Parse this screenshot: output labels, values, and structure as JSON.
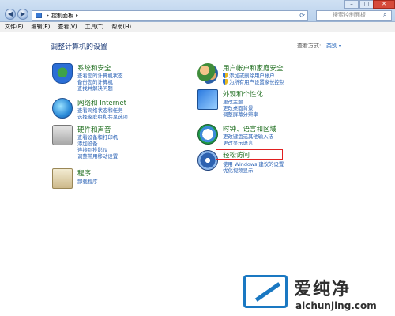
{
  "window": {
    "breadcrumb": [
      "控制面板"
    ],
    "search_placeholder": "搜索控制面板",
    "controls": {
      "minimize": "–",
      "maximize": "□",
      "close": "✕"
    }
  },
  "menu": [
    "文件(F)",
    "编辑(E)",
    "查看(V)",
    "工具(T)",
    "帮助(H)"
  ],
  "header": {
    "title": "调整计算机的设置",
    "view_by_label": "查看方式:",
    "view_by_value": "类别"
  },
  "categories": {
    "security": {
      "title": "系统和安全",
      "links": [
        "查看您的计算机状态",
        "备份您的计算机",
        "查找并解决问题"
      ],
      "icon": "shield-icon"
    },
    "network": {
      "title": "网络和 Internet",
      "links": [
        "查看网络状态和任务",
        "选择家庭组和共享选项"
      ],
      "icon": "globe-icon"
    },
    "hardware": {
      "title": "硬件和声音",
      "links": [
        "查看设备和打印机",
        "添加设备",
        "连接到投影仪",
        "调整常用移动设置"
      ],
      "icon": "printer-icon"
    },
    "programs": {
      "title": "程序",
      "links": [
        "卸载程序"
      ],
      "icon": "programs-icon"
    },
    "users": {
      "title": "用户帐户和家庭安全",
      "links": [
        "添加或删除用户帐户",
        "为所有用户设置家长控制"
      ],
      "icon": "users-icon"
    },
    "appearance": {
      "title": "外观和个性化",
      "links": [
        "更改主题",
        "更改桌面背景",
        "调整屏幕分辨率"
      ],
      "icon": "monitor-icon"
    },
    "clock": {
      "title": "时钟、语言和区域",
      "links": [
        "更改键盘或其他输入法",
        "更改显示语言"
      ],
      "icon": "clock-globe-icon"
    },
    "access": {
      "title": "轻松访问",
      "links": [
        "使用 Windows 建议的设置",
        "优化视频显示"
      ],
      "icon": "accessibility-icon"
    }
  },
  "watermark": {
    "name": "爱纯净",
    "url": "aichunjing.com"
  },
  "colors": {
    "category_title": "#1f6e1f",
    "link": "#2a62b5",
    "highlight": "#e02020"
  }
}
